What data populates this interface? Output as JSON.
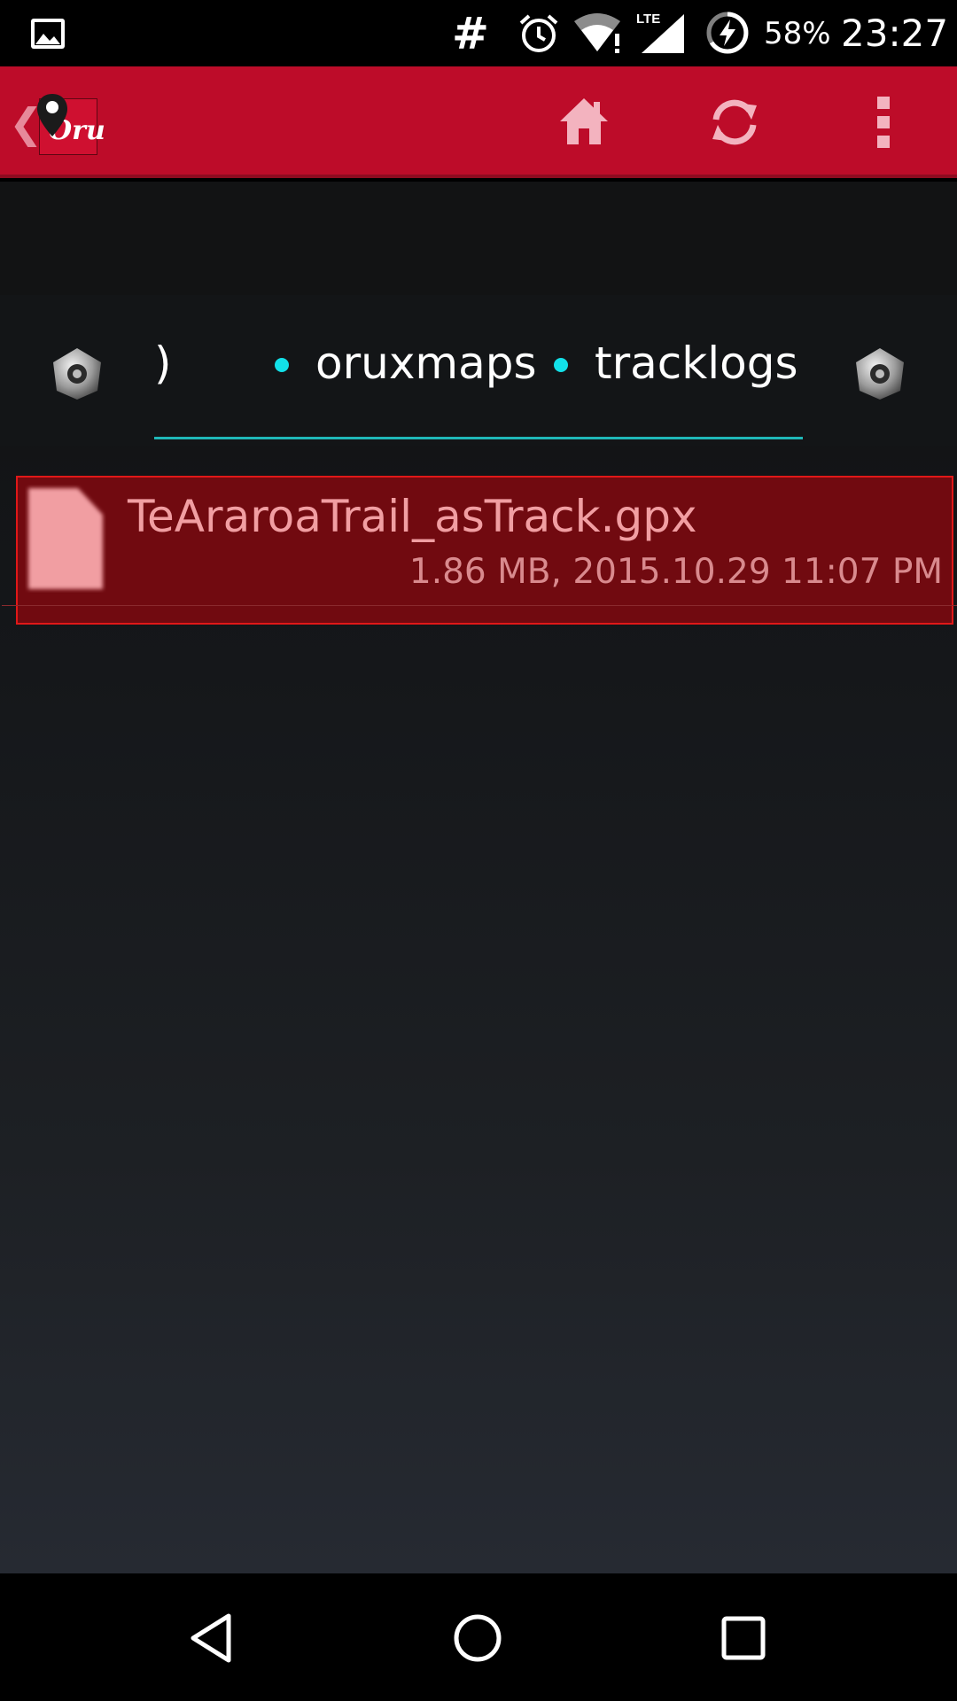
{
  "status_bar": {
    "icons": [
      "gallery-icon",
      "hash-icon",
      "alarm-icon",
      "wifi-icon",
      "lte-signal-icon",
      "battery-charging-icon"
    ],
    "hash_glyph": "#",
    "battery": "58%",
    "time": "23:27"
  },
  "action_bar": {
    "back_glyph": "❮",
    "logo_text": "Oru",
    "actions": [
      "home-icon",
      "refresh-icon",
      "overflow-menu-icon"
    ],
    "accent_color": "#bd0c29"
  },
  "breadcrumb": {
    "partial_segment": ")",
    "segments": [
      "oruxmaps",
      "tracklogs"
    ],
    "separator_color": "#12e0e8",
    "underline_color": "#1fb8b8"
  },
  "files": [
    {
      "name": "TeAraroaTrail_asTrack.gpx",
      "meta": "1.86 MB, 2015.10.29 11:07 PM",
      "selected": true,
      "icon": "file-icon"
    }
  ],
  "nav_bar": {
    "buttons": [
      "back-triangle-icon",
      "home-circle-icon",
      "recents-square-icon"
    ]
  }
}
